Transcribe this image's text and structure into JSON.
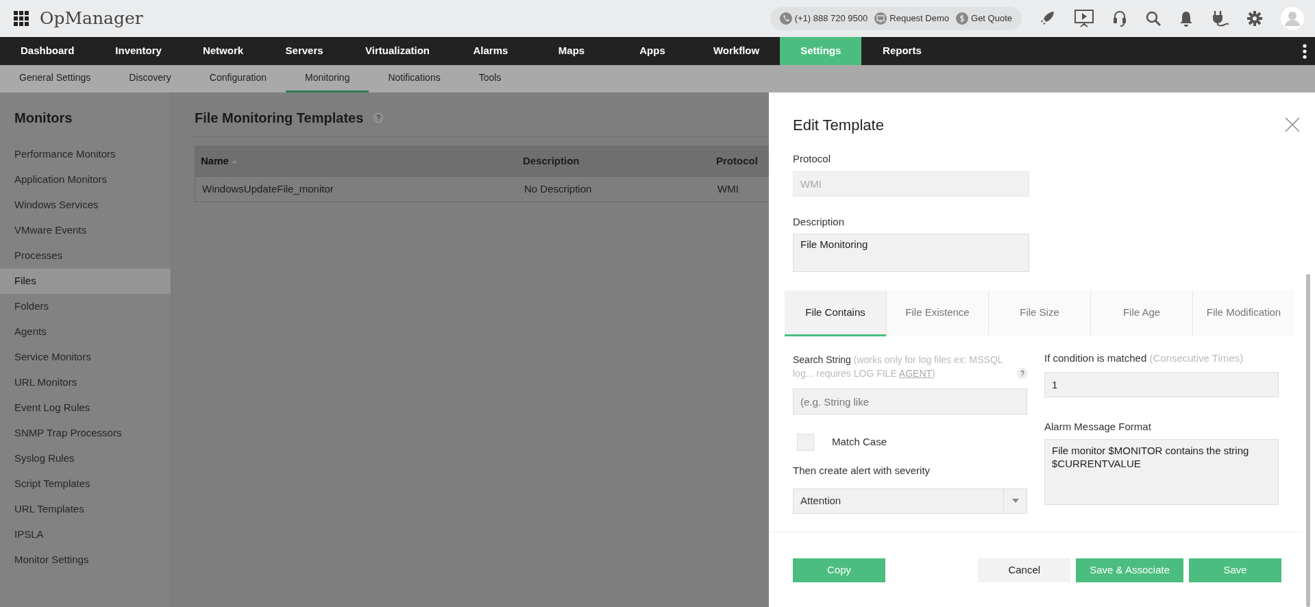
{
  "app": {
    "title": "OpManager"
  },
  "contact": [
    {
      "kind": "phone",
      "label": "(+1) 888 720 9500"
    },
    {
      "kind": "demo",
      "label": "Request Demo"
    },
    {
      "kind": "quote",
      "label": "Get Quote"
    }
  ],
  "nav": [
    {
      "label": "Dashboard",
      "selected": false
    },
    {
      "label": "Inventory",
      "selected": false
    },
    {
      "label": "Network",
      "selected": false
    },
    {
      "label": "Servers",
      "selected": false
    },
    {
      "label": "Virtualization",
      "selected": false
    },
    {
      "label": "Alarms",
      "selected": false
    },
    {
      "label": "Maps",
      "selected": false
    },
    {
      "label": "Apps",
      "selected": false
    },
    {
      "label": "Workflow",
      "selected": false
    },
    {
      "label": "Settings",
      "selected": true
    },
    {
      "label": "Reports",
      "selected": false
    }
  ],
  "subnav": [
    {
      "label": "General Settings",
      "selected": false
    },
    {
      "label": "Discovery",
      "selected": false
    },
    {
      "label": "Configuration",
      "selected": false
    },
    {
      "label": "Monitoring",
      "selected": true
    },
    {
      "label": "Notifications",
      "selected": false
    },
    {
      "label": "Tools",
      "selected": false
    }
  ],
  "sidebar": {
    "title": "Monitors",
    "items": [
      {
        "label": "Performance Monitors",
        "selected": false
      },
      {
        "label": "Application Monitors",
        "selected": false
      },
      {
        "label": "Windows Services",
        "selected": false
      },
      {
        "label": "VMware Events",
        "selected": false
      },
      {
        "label": "Processes",
        "selected": false
      },
      {
        "label": "Files",
        "selected": true
      },
      {
        "label": "Folders",
        "selected": false
      },
      {
        "label": "Agents",
        "selected": false
      },
      {
        "label": "Service Monitors",
        "selected": false
      },
      {
        "label": "URL Monitors",
        "selected": false
      },
      {
        "label": "Event Log Rules",
        "selected": false
      },
      {
        "label": "SNMP Trap Processors",
        "selected": false
      },
      {
        "label": "Syslog Rules",
        "selected": false
      },
      {
        "label": "Script Templates",
        "selected": false
      },
      {
        "label": "URL Templates",
        "selected": false
      },
      {
        "label": "IPSLA",
        "selected": false
      },
      {
        "label": "Monitor Settings",
        "selected": false
      }
    ]
  },
  "main": {
    "title": "File Monitoring Templates",
    "help": "?",
    "table": {
      "columns": [
        {
          "label": "Name",
          "sorted": true
        },
        {
          "label": "Description",
          "sorted": false
        },
        {
          "label": "Protocol",
          "sorted": false
        }
      ],
      "rows": [
        [
          "WindowsUpdateFile_monitor",
          "No Description",
          "WMI"
        ]
      ]
    }
  },
  "panel": {
    "title": "Edit Template",
    "protocol": {
      "label": "Protocol",
      "value": "WMI"
    },
    "description": {
      "label": "Description",
      "value": "File Monitoring"
    },
    "tabs": [
      {
        "label": "File Contains",
        "selected": true
      },
      {
        "label": "File Existence",
        "selected": false
      },
      {
        "label": "File Size",
        "selected": false
      },
      {
        "label": "File Age",
        "selected": false
      },
      {
        "label": "File Modification",
        "selected": false
      }
    ],
    "search_string": {
      "label": "Search String",
      "hint": "(works only for log files ex: MSSQL log... requires LOG FILE",
      "link": "AGENT",
      "hint_end": ")",
      "help": "?",
      "placeholder": "(e.g. String like"
    },
    "condition": {
      "label": "If condition is matched",
      "hint": "(Consecutive Times)",
      "value": "1"
    },
    "match_case": {
      "label": "Match Case",
      "checked": false
    },
    "severity": {
      "label": "Then create alert with severity",
      "value": "Attention"
    },
    "alarm_message": {
      "label": "Alarm Message Format",
      "value": "File monitor $MONITOR contains the string $CURRENTVALUE"
    },
    "footer": {
      "left": [
        {
          "label": "Copy",
          "kind": "primary"
        }
      ],
      "right": [
        {
          "label": "Cancel",
          "kind": "secondary"
        },
        {
          "label": "Save & Associate",
          "kind": "primary"
        },
        {
          "label": "Save",
          "kind": "primary"
        }
      ]
    }
  }
}
